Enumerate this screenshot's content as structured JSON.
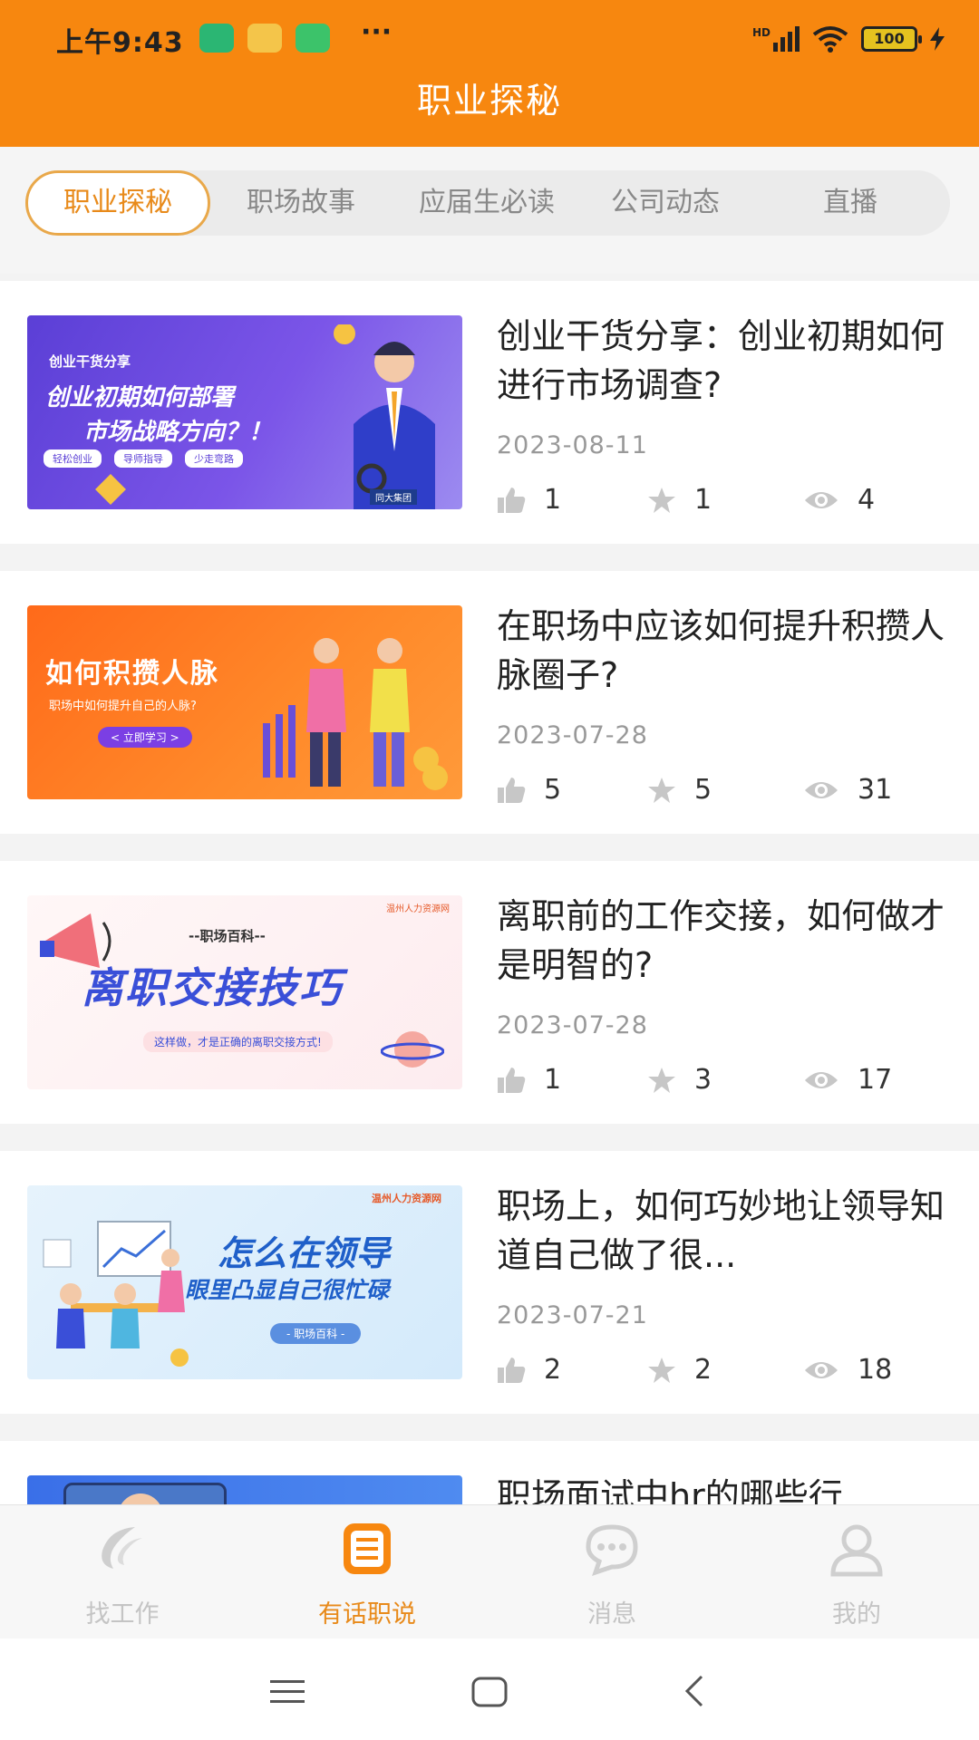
{
  "status": {
    "time": "上午9:43",
    "more": "···",
    "signal_label": "HD",
    "battery": "100"
  },
  "header": {
    "title": "职业探秘"
  },
  "tabs": [
    {
      "label": "职业探秘",
      "active": true
    },
    {
      "label": "职场故事",
      "active": false
    },
    {
      "label": "应届生必读",
      "active": false
    },
    {
      "label": "公司动态",
      "active": false
    },
    {
      "label": "直播",
      "active": false
    }
  ],
  "articles": [
    {
      "title": "创业干货分享：创业初期如何进行市场调查?",
      "date": "2023-08-11",
      "likes": "1",
      "stars": "1",
      "views": "4",
      "thumb": {
        "small": "创业干货分享",
        "line1": "创业初期如何部署",
        "line2": "市场战略方向？！",
        "pills": [
          "轻松创业",
          "导师指导",
          "少走弯路"
        ],
        "brand": "同大集团"
      }
    },
    {
      "title": "在职场中应该如何提升积攒人脉圈子?",
      "date": "2023-07-28",
      "likes": "5",
      "stars": "5",
      "views": "31",
      "thumb": {
        "line1": "如何积攒人脉",
        "sub": "职场中如何提升自己的人脉?",
        "button": "< 立即学习 >"
      }
    },
    {
      "title": "离职前的工作交接，如何做才是明智的?",
      "date": "2023-07-28",
      "likes": "1",
      "stars": "3",
      "views": "17",
      "thumb": {
        "small": "--职场百科--",
        "line1": "离职交接技巧",
        "sub": "这样做，才是正确的离职交接方式!",
        "brand": "温州人力资源网"
      }
    },
    {
      "title": "职场上，如何巧妙地让领导知道自己做了很...",
      "date": "2023-07-21",
      "likes": "2",
      "stars": "2",
      "views": "18",
      "thumb": {
        "brand": "温州人力资源网",
        "line1": "怎么在领导",
        "line2": "眼里凸显自己很忙碌",
        "pill": "- 职场百科 -"
      }
    },
    {
      "title": "职场面试中hr的哪些行",
      "date": "",
      "likes": "",
      "stars": "",
      "views": "",
      "thumb": {}
    }
  ],
  "bottom_nav": [
    {
      "label": "找工作",
      "icon": "jobs-logo-icon",
      "active": false
    },
    {
      "label": "有话职说",
      "icon": "document-icon",
      "active": true
    },
    {
      "label": "消息",
      "icon": "chat-bubble-icon",
      "active": false
    },
    {
      "label": "我的",
      "icon": "person-icon",
      "active": false
    }
  ],
  "colors": {
    "brand_orange": "#f7870f",
    "tab_active_text": "#e88a1a",
    "tab_active_border": "#e9a84a"
  }
}
